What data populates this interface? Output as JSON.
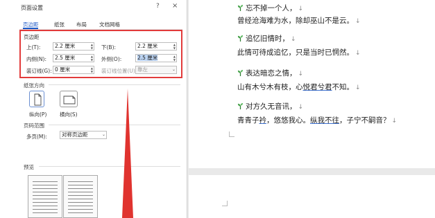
{
  "dialog": {
    "title": "页面设置",
    "help": "?",
    "close": "×",
    "tabs": [
      {
        "label": "页边距"
      },
      {
        "label": "纸张"
      },
      {
        "label": "布局"
      },
      {
        "label": "文档网格"
      }
    ],
    "margins": {
      "section": "页边距",
      "top_label": "上(T):",
      "top_value": "2.2 厘米",
      "bottom_label": "下(B):",
      "bottom_value": "2.2 厘米",
      "inside_label": "内侧(N):",
      "inside_value": "2.5 厘米",
      "outside_label": "外侧(O):",
      "outside_value": "2.5 厘米",
      "gutter_label": "装订线(G):",
      "gutter_value": "0 厘米",
      "gutter_pos_label": "装订线位置(U):",
      "gutter_pos_value": "靠左"
    },
    "orientation": {
      "section": "纸张方向",
      "portrait": "纵向(P)",
      "landscape": "横向(S)"
    },
    "pages": {
      "section": "页码范围",
      "multiple_label": "多页(M):",
      "multiple_value": "对称页边距"
    },
    "preview": {
      "section": "预览"
    }
  },
  "document": {
    "lines": [
      {
        "text": "忘不掉一个人，",
        "icon": true
      },
      {
        "text": "曾经沧海难为水，除却巫山不是云。",
        "icon": false
      },
      {
        "text": "追忆旧情时，",
        "icon": true
      },
      {
        "text": "此情可待成追忆，只是当时已惘然。",
        "icon": false
      },
      {
        "text": "表达暗恋之情，",
        "icon": true
      },
      {
        "pre": "山有木兮木有枝，心",
        "ul": "悦君兮君",
        "post": "不知。",
        "icon": false
      },
      {
        "text": "对方久无音讯，",
        "icon": true
      },
      {
        "pre": "青青子",
        "ul": "衿",
        "mid": "，悠悠我心。",
        "ul2": "纵我不往",
        "post": "，子宁不嗣音？",
        "icon": false
      }
    ],
    "paragraph_mark": "↓"
  },
  "colors": {
    "highlight_box": "#e23b3b",
    "tab_active": "#1a56c4",
    "selection": "#bcd4f3"
  }
}
